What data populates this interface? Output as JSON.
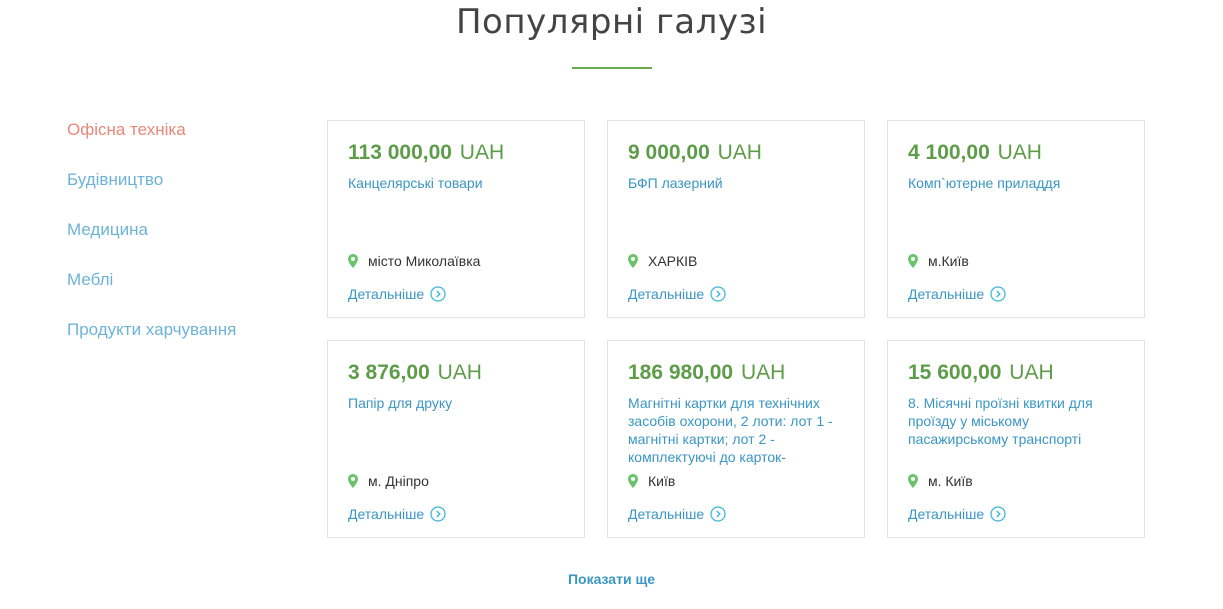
{
  "page": {
    "title": "Популярні галузі",
    "show_more_label": "Показати ще"
  },
  "colors": {
    "accent_green": "#5d9c48",
    "link_blue": "#3a96c4",
    "sidebar_blue": "#6db3d9",
    "active_salmon": "#e8887a"
  },
  "sidebar": {
    "items": [
      {
        "label": "Офісна техніка",
        "active": true
      },
      {
        "label": "Будівництво",
        "active": false
      },
      {
        "label": "Медицина",
        "active": false
      },
      {
        "label": "Меблі",
        "active": false
      },
      {
        "label": "Продукти харчування",
        "active": false
      }
    ]
  },
  "cards": [
    {
      "amount": "113 000,00",
      "currency": "UAH",
      "name": "Канцелярські товари",
      "location": "місто Миколаївка",
      "details_label": "Детальніше"
    },
    {
      "amount": "9 000,00",
      "currency": "UAH",
      "name": "БФП лазерний",
      "location": "ХАРКІВ",
      "details_label": "Детальніше"
    },
    {
      "amount": "4 100,00",
      "currency": "UAH",
      "name": "Комп`ютерне приладдя",
      "location": "м.Київ",
      "details_label": "Детальніше"
    },
    {
      "amount": "3 876,00",
      "currency": "UAH",
      "name": "Папір для друку",
      "location": "м. Дніпро",
      "details_label": "Детальніше"
    },
    {
      "amount": "186 980,00",
      "currency": "UAH",
      "name": "Магнітні картки для технічних засобів охорони, 2 лоти: лот 1 - магнітні картки; лот 2 - комплектуючі до карток-",
      "location": "Київ",
      "details_label": "Детальніше"
    },
    {
      "amount": "15 600,00",
      "currency": "UAH",
      "name": "8. Місячні проїзні квитки для проїзду у міському пасажирському транспорті",
      "location": "м. Київ",
      "details_label": "Детальніше"
    }
  ],
  "icons": {
    "location": "map-pin-icon",
    "details": "circle-chevron-right-icon"
  }
}
